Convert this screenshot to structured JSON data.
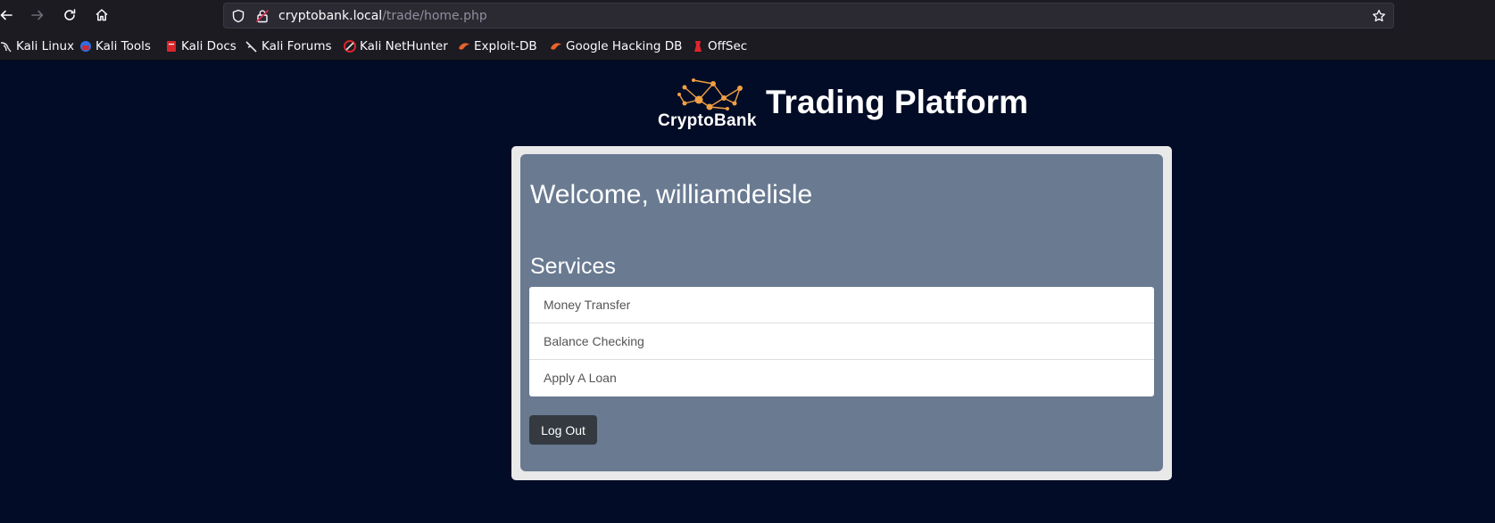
{
  "browser": {
    "url_host": "cryptobank.local",
    "url_path": "/trade/home.php",
    "bookmarks": [
      {
        "label": "Kali Linux",
        "icon": "kali-dragon-icon",
        "color": "#e6e6e6"
      },
      {
        "label": "Kali Tools",
        "icon": "kali-tools-icon",
        "color": "#2f6fe0"
      },
      {
        "label": "Kali Docs",
        "icon": "kali-docs-icon",
        "color": "#d7262b"
      },
      {
        "label": "Kali Forums",
        "icon": "kali-forums-icon",
        "color": "#e6e6e6"
      },
      {
        "label": "Kali NetHunter",
        "icon": "kali-nethunter-icon",
        "color": "#d7262b"
      },
      {
        "label": "Exploit-DB",
        "icon": "exploit-db-icon",
        "color": "#e8632a"
      },
      {
        "label": "Google Hacking DB",
        "icon": "ghdb-icon",
        "color": "#e8632a"
      },
      {
        "label": "OffSec",
        "icon": "offsec-icon",
        "color": "#e0262b"
      }
    ]
  },
  "header": {
    "logo_text": "CryptoBank",
    "title": "Trading Platform"
  },
  "main": {
    "welcome": "Welcome, williamdelisle",
    "services_heading": "Services",
    "services": [
      {
        "label": "Money Transfer"
      },
      {
        "label": "Balance Checking"
      },
      {
        "label": "Apply A Loan"
      }
    ],
    "logout_label": "Log Out"
  },
  "colors": {
    "page_bg": "#020c26",
    "card_bg": "#697a91",
    "logo_accent": "#f0a043",
    "button_bg": "#343a40"
  }
}
